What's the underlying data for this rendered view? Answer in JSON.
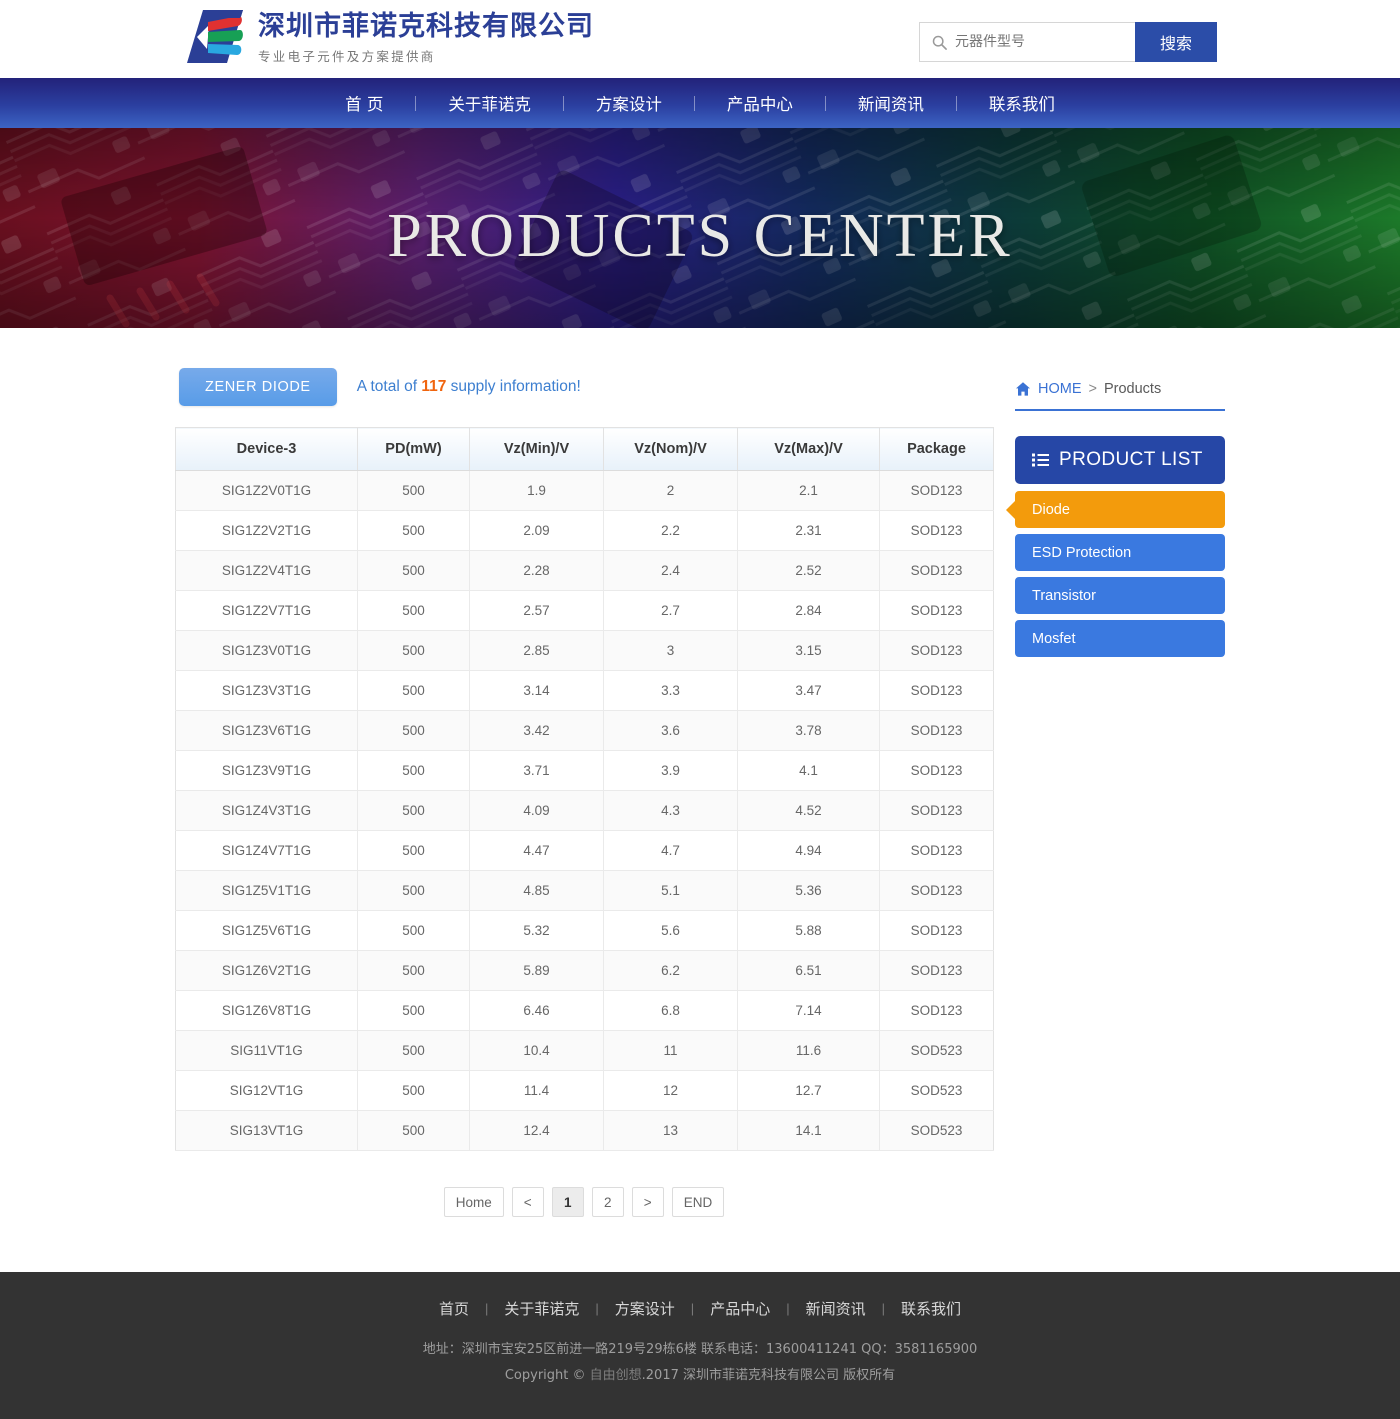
{
  "header": {
    "logo": {
      "icon": "company-diamond-logo",
      "title": "深圳市菲诺克科技有限公司",
      "subtitle": "专业电子元件及方案提供商",
      "brand_color": "#2b3f96",
      "stripe_colors": [
        "#e03131",
        "#17a055",
        "#29a8e0"
      ]
    },
    "search": {
      "icon": "search-icon",
      "placeholder": "元器件型号",
      "value": "",
      "button_label": "搜索",
      "button_color": "#2b4da8"
    }
  },
  "nav": {
    "items": [
      {
        "label": "首 页"
      },
      {
        "label": "关于菲诺克"
      },
      {
        "label": "方案设计"
      },
      {
        "label": "产品中心"
      },
      {
        "label": "新闻资讯"
      },
      {
        "label": "联系我们"
      }
    ]
  },
  "hero": {
    "title": "PRODUCTS CENTER"
  },
  "content": {
    "category_tab": "ZENER DIODE",
    "supply_prefix": "A total of",
    "supply_count": "117",
    "supply_suffix": "supply information!",
    "supply_count_color": "#f0650f",
    "table": {
      "columns": [
        "Device-3",
        "PD(mW)",
        "Vz(Min)/V",
        "Vz(Nom)/V",
        "Vz(Max)/V",
        "Package"
      ],
      "rows": [
        [
          "SIG1Z2V0T1G",
          "500",
          "1.9",
          "2",
          "2.1",
          "SOD123"
        ],
        [
          "SIG1Z2V2T1G",
          "500",
          "2.09",
          "2.2",
          "2.31",
          "SOD123"
        ],
        [
          "SIG1Z2V4T1G",
          "500",
          "2.28",
          "2.4",
          "2.52",
          "SOD123"
        ],
        [
          "SIG1Z2V7T1G",
          "500",
          "2.57",
          "2.7",
          "2.84",
          "SOD123"
        ],
        [
          "SIG1Z3V0T1G",
          "500",
          "2.85",
          "3",
          "3.15",
          "SOD123"
        ],
        [
          "SIG1Z3V3T1G",
          "500",
          "3.14",
          "3.3",
          "3.47",
          "SOD123"
        ],
        [
          "SIG1Z3V6T1G",
          "500",
          "3.42",
          "3.6",
          "3.78",
          "SOD123"
        ],
        [
          "SIG1Z3V9T1G",
          "500",
          "3.71",
          "3.9",
          "4.1",
          "SOD123"
        ],
        [
          "SIG1Z4V3T1G",
          "500",
          "4.09",
          "4.3",
          "4.52",
          "SOD123"
        ],
        [
          "SIG1Z4V7T1G",
          "500",
          "4.47",
          "4.7",
          "4.94",
          "SOD123"
        ],
        [
          "SIG1Z5V1T1G",
          "500",
          "4.85",
          "5.1",
          "5.36",
          "SOD123"
        ],
        [
          "SIG1Z5V6T1G",
          "500",
          "5.32",
          "5.6",
          "5.88",
          "SOD123"
        ],
        [
          "SIG1Z6V2T1G",
          "500",
          "5.89",
          "6.2",
          "6.51",
          "SOD123"
        ],
        [
          "SIG1Z6V8T1G",
          "500",
          "6.46",
          "6.8",
          "7.14",
          "SOD123"
        ],
        [
          "SIG11VT1G",
          "500",
          "10.4",
          "11",
          "11.6",
          "SOD523"
        ],
        [
          "SIG12VT1G",
          "500",
          "11.4",
          "12",
          "12.7",
          "SOD523"
        ],
        [
          "SIG13VT1G",
          "500",
          "12.4",
          "13",
          "14.1",
          "SOD523"
        ]
      ]
    },
    "pagination": {
      "items": [
        {
          "label": "Home",
          "active": false
        },
        {
          "label": "<",
          "active": false
        },
        {
          "label": "1",
          "active": true
        },
        {
          "label": "2",
          "active": false
        },
        {
          "label": ">",
          "active": false
        },
        {
          "label": "END",
          "active": false
        }
      ]
    }
  },
  "sidebar": {
    "breadcrumb": {
      "icon": "home-icon",
      "home": "HOME",
      "separator": ">",
      "current": "Products"
    },
    "product_list": {
      "icon": "list-icon",
      "title": "PRODUCT LIST",
      "header_color": "#2647a6",
      "active_color": "#f39b0c",
      "item_color": "#3a79e0",
      "items": [
        {
          "label": "Diode",
          "active": true
        },
        {
          "label": "ESD Protection",
          "active": false
        },
        {
          "label": "Transistor",
          "active": false
        },
        {
          "label": "Mosfet",
          "active": false
        }
      ]
    }
  },
  "footer": {
    "nav": [
      {
        "label": "首页"
      },
      {
        "label": "关于菲诺克"
      },
      {
        "label": "方案设计"
      },
      {
        "label": "产品中心"
      },
      {
        "label": "新闻资讯"
      },
      {
        "label": "联系我们"
      }
    ],
    "separator": "|",
    "address": "地址：深圳市宝安25区前进一路219号29栋6楼 联系电话：13600411241 QQ：3581165900",
    "copyright_pre": "Copyright © ",
    "copyright_link": "自由创想",
    "copyright_post": ".2017 深圳市菲诺克科技有限公司 版权所有"
  }
}
